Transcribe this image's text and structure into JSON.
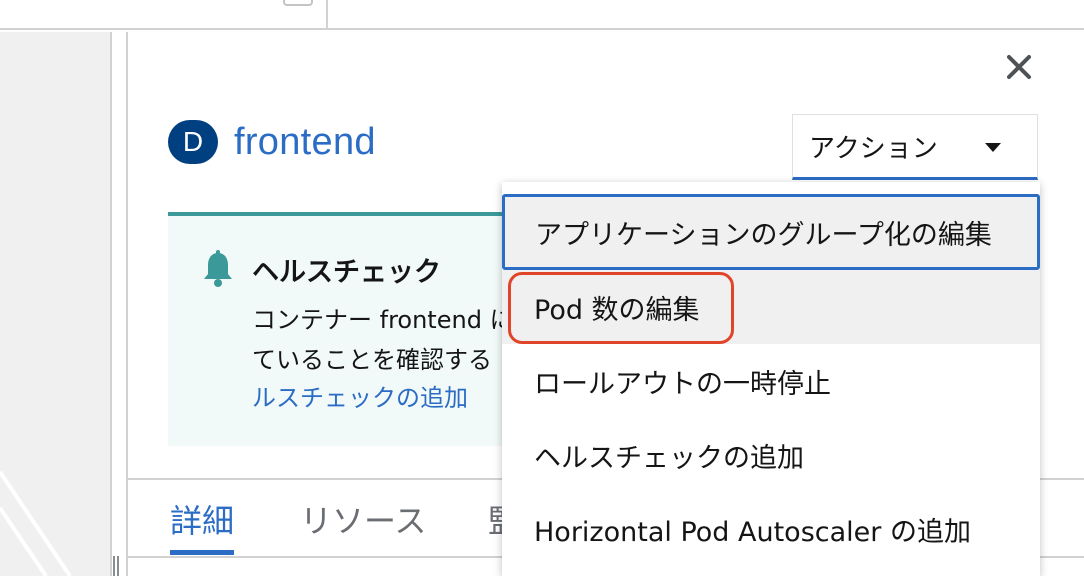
{
  "panel": {
    "title": "frontend",
    "kind_badge": "D",
    "close_icon": "close-icon",
    "actions_label": "アクション"
  },
  "alert": {
    "title": "ヘルスチェック",
    "line1": "コンテナー frontend に",
    "line2": "ていることを確認する",
    "link": "ルスチェックの追加",
    "icon": "bell-icon",
    "accent": "#3b9a99"
  },
  "tabs": [
    {
      "label": "詳細",
      "active": true
    },
    {
      "label": "リソース",
      "active": false
    },
    {
      "label": "監",
      "active": false
    }
  ],
  "menu": {
    "items": [
      {
        "label": "アプリケーションのグループ化の編集"
      },
      {
        "label": "Pod 数の編集"
      },
      {
        "label": "ロールアウトの一時停止"
      },
      {
        "label": "ヘルスチェックの追加"
      },
      {
        "label": "Horizontal Pod Autoscaler の追加"
      }
    ]
  },
  "colors": {
    "brand": "#2b6cc4",
    "badge": "#004080",
    "highlight": "#e0452a"
  }
}
